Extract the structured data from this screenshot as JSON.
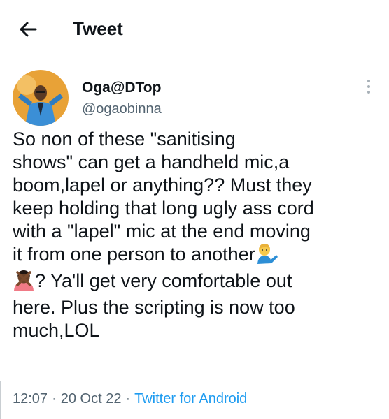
{
  "header": {
    "title": "Tweet",
    "back_icon": "arrow-left-icon"
  },
  "author": {
    "display_name": "Oga@DTop",
    "handle": "@ogaobinna",
    "avatar_bg": "#e8a237"
  },
  "more_icon": "more-vertical-icon",
  "tweet": {
    "lines": [
      "So non of these \"sanitising",
      "shows\" can get a handheld mic,a",
      "boom,lapel or anything?? Must they",
      "keep holding that long ugly ass cord",
      "with a \"lapel\" mic at the end moving",
      "it from one person to another",
      "? Ya'll get very comfortable out",
      "here. Plus the scripting is now too",
      "much,LOL"
    ],
    "emojis": [
      "man-tipping-hand-emoji",
      "person-gesturing-no-emoji"
    ]
  },
  "meta": {
    "time": "12:07",
    "separator": "·",
    "date": "20 Oct 22",
    "source": "Twitter for Android"
  },
  "colors": {
    "text": "#0f1419",
    "secondary": "#536471",
    "accent": "#1d9bf0"
  }
}
